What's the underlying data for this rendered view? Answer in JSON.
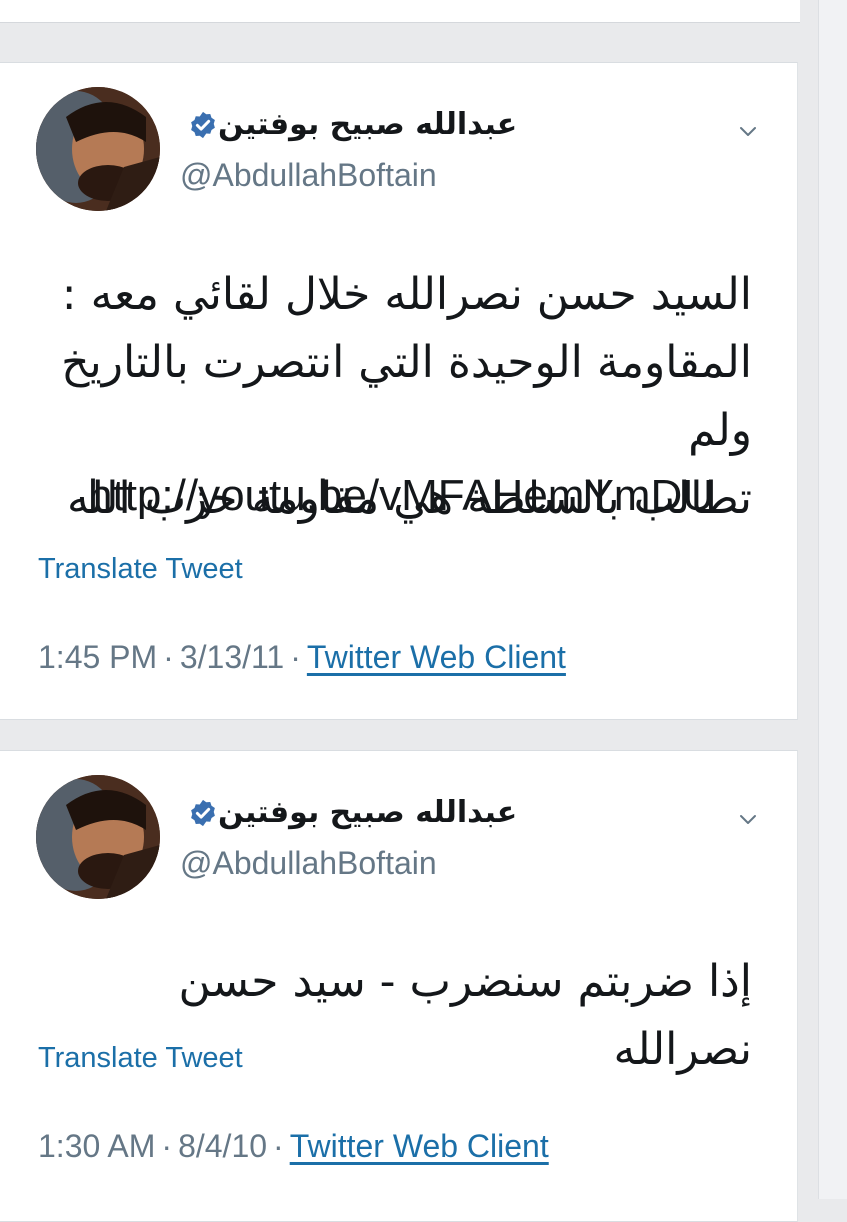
{
  "tweets": [
    {
      "display_name": "عبدالله صبيح بوفتين",
      "handle": "@AbdullahBoftain",
      "verified": true,
      "text_line1": "السيد حسن نصرالله خلال لقائي معه :",
      "text_line2": "المقاومة الوحيدة التي انتصرت بالتاريخ ولم",
      "text_line3": "تطالب بالسلطة هي مقاومة حزب الله",
      "link": "http://youtu.be/vMFAHemYmDU",
      "translate_label": "Translate Tweet",
      "time": "1:45 PM",
      "date": "3/13/11",
      "separator": "·",
      "client": "Twitter Web Client"
    },
    {
      "display_name": "عبدالله صبيح بوفتين",
      "handle": "@AbdullahBoftain",
      "verified": true,
      "text_line1": "إذا ضربتم سنضرب - سيد حسن نصرالله",
      "translate_label": "Translate Tweet",
      "time": "1:30 AM",
      "date": "8/4/10",
      "separator": "·",
      "client": "Twitter Web Client"
    }
  ],
  "colors": {
    "link_blue": "#1b6fa8",
    "verified_blue": "#1d9bf0",
    "secondary_text": "#657786",
    "primary_text": "#14171a"
  },
  "icons": {
    "verified": "verified-badge-icon",
    "menu": "chevron-down-icon"
  }
}
